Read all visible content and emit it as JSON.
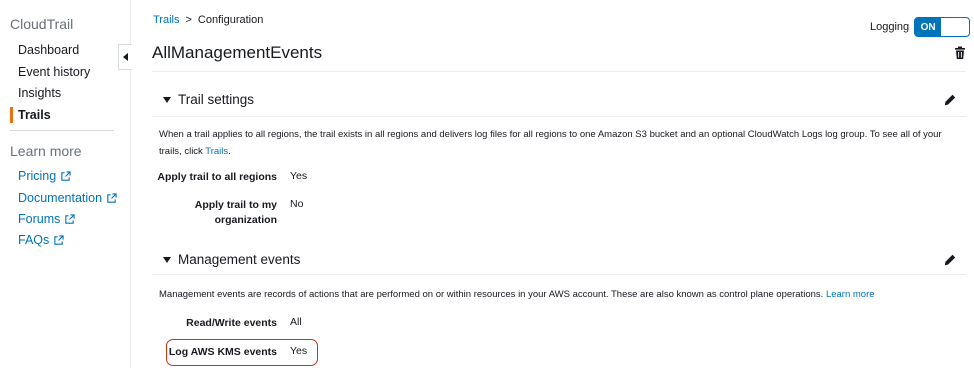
{
  "sidebar": {
    "title": "CloudTrail",
    "items": [
      {
        "label": "Dashboard"
      },
      {
        "label": "Event history"
      },
      {
        "label": "Insights"
      },
      {
        "label": "Trails"
      }
    ],
    "learn_more": "Learn more",
    "links": [
      {
        "label": "Pricing"
      },
      {
        "label": "Documentation"
      },
      {
        "label": "Forums"
      },
      {
        "label": "FAQs"
      }
    ]
  },
  "breadcrumb": {
    "link": "Trails",
    "separator": ">",
    "current": "Configuration"
  },
  "page": {
    "title": "AllManagementEvents"
  },
  "logging": {
    "label": "Logging",
    "state": "ON"
  },
  "trail_settings": {
    "title": "Trail settings",
    "description": "When a trail applies to all regions, the trail exists in all regions and delivers log files for all regions to one Amazon S3 bucket and an optional CloudWatch Logs log group. To see all of your trails, click ",
    "description_link": "Trails",
    "description_end": ".",
    "fields": [
      {
        "key": "Apply trail to all regions",
        "value": "Yes"
      },
      {
        "key_line1": "Apply trail to my",
        "key_line2": "organization",
        "value": "No"
      }
    ]
  },
  "management_events": {
    "title": "Management events",
    "description": "Management events are records of actions that are performed on or within resources in your AWS account. These are also known as control plane operations. ",
    "description_link": "Learn more",
    "fields": [
      {
        "key": "Read/Write events",
        "value": "All"
      },
      {
        "key": "Log AWS KMS events",
        "value": "Yes"
      }
    ]
  },
  "colors": {
    "link": "#0073bb",
    "active_accent": "#ec7211",
    "highlight": "#d13212"
  },
  "icons": [
    "chevron-left-icon",
    "trash-icon",
    "caret-down-icon",
    "pencil-icon",
    "external-link-icon"
  ]
}
